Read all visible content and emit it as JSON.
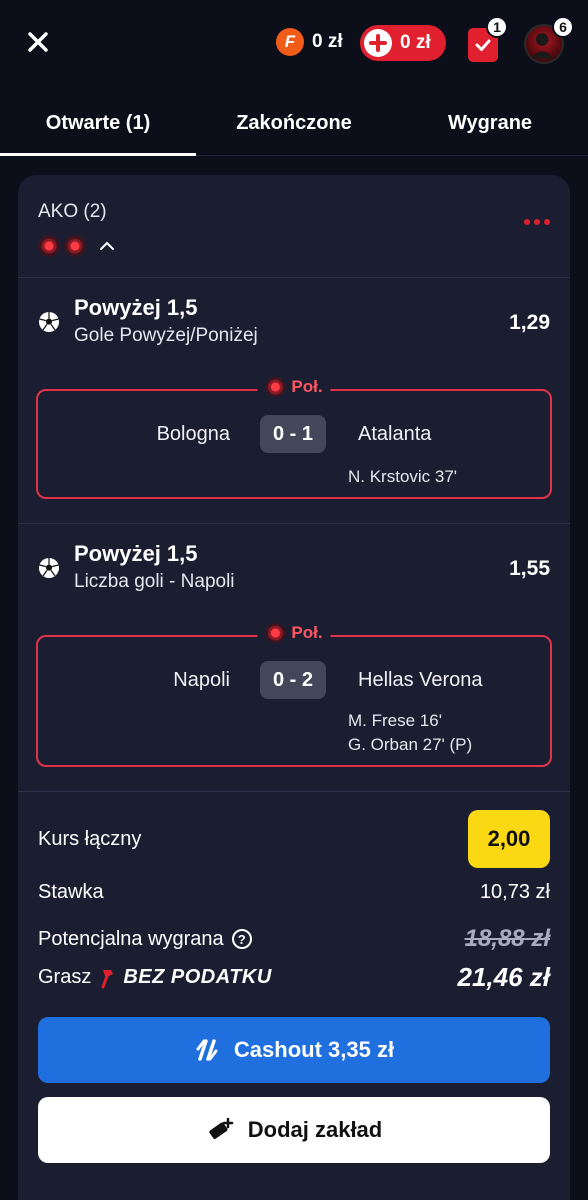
{
  "header": {
    "fcoins_amount": "0 zł",
    "deposit_amount": "0 zł",
    "betslip_count": "1",
    "notifications_count": "6"
  },
  "tabs": [
    {
      "label": "Otwarte (1)",
      "active": true
    },
    {
      "label": "Zakończone",
      "active": false
    },
    {
      "label": "Wygrane",
      "active": false
    }
  ],
  "coupon": {
    "title": "AKO (2)",
    "bets": [
      {
        "selection": "Powyżej 1,5",
        "market": "Gole Powyżej/Poniżej",
        "odds": "1,29",
        "status": "Poł.",
        "home": "Bologna",
        "score": "0 - 1",
        "away": "Atalanta",
        "scorers": [
          "N. Krstovic 37'"
        ]
      },
      {
        "selection": "Powyżej 1,5",
        "market": "Liczba goli - Napoli",
        "odds": "1,55",
        "status": "Poł.",
        "home": "Napoli",
        "score": "0 - 2",
        "away": "Hellas Verona",
        "scorers": [
          "M. Frese 16'",
          "G. Orban 27' (P)"
        ]
      }
    ],
    "summary": {
      "total_odds_label": "Kurs łączny",
      "total_odds": "2,00",
      "stake_label": "Stawka",
      "stake": "10,73 zł",
      "potential_label": "Potencjalna wygrana",
      "potential_old": "18,88 zł",
      "play_label": "Grasz",
      "no_tax_label": "BEZ PODATKU",
      "potential_new": "21,46 zł"
    },
    "cashout_label": "Cashout 3,35 zł",
    "add_bet_label": "Dodaj zakład"
  },
  "colors": {
    "background": "#0c0e1a",
    "card": "#1b1e31",
    "accent_red": "#e0202f",
    "cashout_blue": "#1f6fde",
    "odds_yellow": "#fbd814"
  }
}
